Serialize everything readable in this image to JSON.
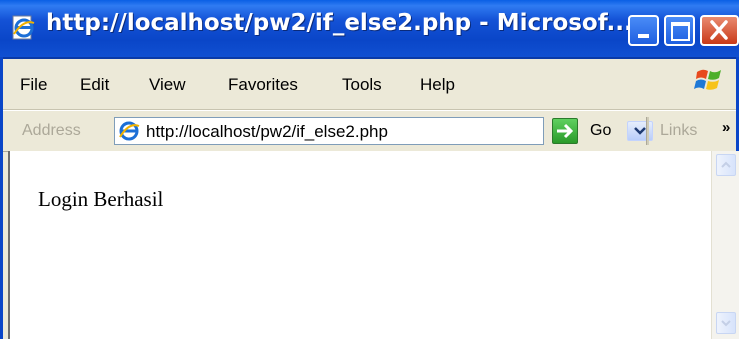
{
  "window": {
    "title": "http://localhost/pw2/if_else2.php - Microsof..."
  },
  "menu": {
    "items": [
      "File",
      "Edit",
      "View",
      "Favorites",
      "Tools",
      "Help"
    ]
  },
  "addressbar": {
    "label": "Address",
    "url": "http://localhost/pw2/if_else2.php",
    "go_label": "Go",
    "links_label": "Links",
    "more_label": "»"
  },
  "page": {
    "text": "Login Berhasil"
  },
  "icons": {
    "title_icon": "ie-page-icon",
    "brand_logo": "windows-flag-logo",
    "minimize": "minimize-icon",
    "maximize": "maximize-icon",
    "close": "close-icon",
    "dropdown": "chevron-down-icon",
    "go": "arrow-right-icon",
    "scroll_up": "chevron-up-icon",
    "scroll_down": "chevron-down-icon"
  },
  "colors": {
    "titlebar": "#0a46c8",
    "close_button": "#c93a18",
    "chrome": "#ece9d8",
    "go_button": "#2a9a2a"
  }
}
